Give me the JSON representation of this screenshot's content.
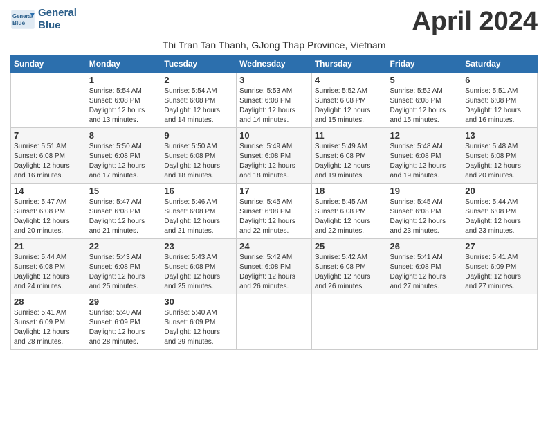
{
  "header": {
    "logo_line1": "General",
    "logo_line2": "Blue",
    "title": "April 2024",
    "subtitle": "Thi Tran Tan Thanh, GJong Thap Province, Vietnam"
  },
  "weekdays": [
    "Sunday",
    "Monday",
    "Tuesday",
    "Wednesday",
    "Thursday",
    "Friday",
    "Saturday"
  ],
  "weeks": [
    [
      {
        "day": "",
        "empty": true
      },
      {
        "day": "1",
        "sunrise": "5:54 AM",
        "sunset": "6:08 PM",
        "daylight": "12 hours and 13 minutes."
      },
      {
        "day": "2",
        "sunrise": "5:54 AM",
        "sunset": "6:08 PM",
        "daylight": "12 hours and 14 minutes."
      },
      {
        "day": "3",
        "sunrise": "5:53 AM",
        "sunset": "6:08 PM",
        "daylight": "12 hours and 14 minutes."
      },
      {
        "day": "4",
        "sunrise": "5:52 AM",
        "sunset": "6:08 PM",
        "daylight": "12 hours and 15 minutes."
      },
      {
        "day": "5",
        "sunrise": "5:52 AM",
        "sunset": "6:08 PM",
        "daylight": "12 hours and 15 minutes."
      },
      {
        "day": "6",
        "sunrise": "5:51 AM",
        "sunset": "6:08 PM",
        "daylight": "12 hours and 16 minutes."
      }
    ],
    [
      {
        "day": "7",
        "sunrise": "5:51 AM",
        "sunset": "6:08 PM",
        "daylight": "12 hours and 16 minutes."
      },
      {
        "day": "8",
        "sunrise": "5:50 AM",
        "sunset": "6:08 PM",
        "daylight": "12 hours and 17 minutes."
      },
      {
        "day": "9",
        "sunrise": "5:50 AM",
        "sunset": "6:08 PM",
        "daylight": "12 hours and 18 minutes."
      },
      {
        "day": "10",
        "sunrise": "5:49 AM",
        "sunset": "6:08 PM",
        "daylight": "12 hours and 18 minutes."
      },
      {
        "day": "11",
        "sunrise": "5:49 AM",
        "sunset": "6:08 PM",
        "daylight": "12 hours and 19 minutes."
      },
      {
        "day": "12",
        "sunrise": "5:48 AM",
        "sunset": "6:08 PM",
        "daylight": "12 hours and 19 minutes."
      },
      {
        "day": "13",
        "sunrise": "5:48 AM",
        "sunset": "6:08 PM",
        "daylight": "12 hours and 20 minutes."
      }
    ],
    [
      {
        "day": "14",
        "sunrise": "5:47 AM",
        "sunset": "6:08 PM",
        "daylight": "12 hours and 20 minutes."
      },
      {
        "day": "15",
        "sunrise": "5:47 AM",
        "sunset": "6:08 PM",
        "daylight": "12 hours and 21 minutes."
      },
      {
        "day": "16",
        "sunrise": "5:46 AM",
        "sunset": "6:08 PM",
        "daylight": "12 hours and 21 minutes."
      },
      {
        "day": "17",
        "sunrise": "5:45 AM",
        "sunset": "6:08 PM",
        "daylight": "12 hours and 22 minutes."
      },
      {
        "day": "18",
        "sunrise": "5:45 AM",
        "sunset": "6:08 PM",
        "daylight": "12 hours and 22 minutes."
      },
      {
        "day": "19",
        "sunrise": "5:45 AM",
        "sunset": "6:08 PM",
        "daylight": "12 hours and 23 minutes."
      },
      {
        "day": "20",
        "sunrise": "5:44 AM",
        "sunset": "6:08 PM",
        "daylight": "12 hours and 23 minutes."
      }
    ],
    [
      {
        "day": "21",
        "sunrise": "5:44 AM",
        "sunset": "6:08 PM",
        "daylight": "12 hours and 24 minutes."
      },
      {
        "day": "22",
        "sunrise": "5:43 AM",
        "sunset": "6:08 PM",
        "daylight": "12 hours and 25 minutes."
      },
      {
        "day": "23",
        "sunrise": "5:43 AM",
        "sunset": "6:08 PM",
        "daylight": "12 hours and 25 minutes."
      },
      {
        "day": "24",
        "sunrise": "5:42 AM",
        "sunset": "6:08 PM",
        "daylight": "12 hours and 26 minutes."
      },
      {
        "day": "25",
        "sunrise": "5:42 AM",
        "sunset": "6:08 PM",
        "daylight": "12 hours and 26 minutes."
      },
      {
        "day": "26",
        "sunrise": "5:41 AM",
        "sunset": "6:08 PM",
        "daylight": "12 hours and 27 minutes."
      },
      {
        "day": "27",
        "sunrise": "5:41 AM",
        "sunset": "6:09 PM",
        "daylight": "12 hours and 27 minutes."
      }
    ],
    [
      {
        "day": "28",
        "sunrise": "5:41 AM",
        "sunset": "6:09 PM",
        "daylight": "12 hours and 28 minutes."
      },
      {
        "day": "29",
        "sunrise": "5:40 AM",
        "sunset": "6:09 PM",
        "daylight": "12 hours and 28 minutes."
      },
      {
        "day": "30",
        "sunrise": "5:40 AM",
        "sunset": "6:09 PM",
        "daylight": "12 hours and 29 minutes."
      },
      {
        "day": "",
        "empty": true
      },
      {
        "day": "",
        "empty": true
      },
      {
        "day": "",
        "empty": true
      },
      {
        "day": "",
        "empty": true
      }
    ]
  ]
}
